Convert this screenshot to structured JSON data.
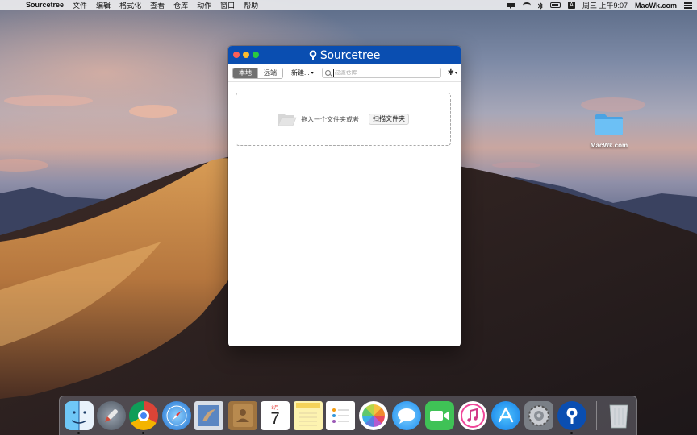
{
  "menubar": {
    "app_name": "Sourcetree",
    "items": [
      "文件",
      "编辑",
      "格式化",
      "查看",
      "仓库",
      "动作",
      "窗口",
      "帮助"
    ],
    "clock": "周三 上午9:07",
    "account": "MacWk.com",
    "input_method": "A"
  },
  "desktop": {
    "folder_label": "MacWk.com"
  },
  "window": {
    "title": "Sourcetree",
    "tabs": [
      {
        "label": "本地",
        "active": true
      },
      {
        "label": "远端",
        "active": false
      }
    ],
    "new_label": "新建...",
    "search_placeholder": "过滤仓库",
    "drop_hint": "拖入一个文件夹或者",
    "scan_label": "扫描文件夹"
  },
  "dock": {
    "apps": [
      "finder-icon",
      "launchpad-icon",
      "chrome-icon",
      "safari-icon",
      "mail-icon",
      "contacts-icon",
      "calendar-icon",
      "notes-icon",
      "reminders-icon",
      "photos-icon",
      "messages-icon",
      "facetime-icon",
      "itunes-icon",
      "app-store-icon",
      "system-preferences-icon",
      "sourcetree-icon",
      "trash-icon"
    ],
    "calendar_month": "8月",
    "calendar_day": "7"
  },
  "colors": {
    "titlebar": "#0a4eb1",
    "accent": "#0052cc"
  }
}
